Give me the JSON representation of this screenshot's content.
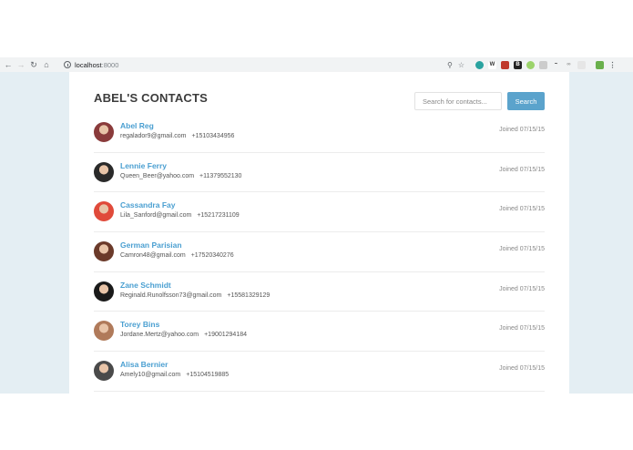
{
  "browser": {
    "url_host": "localhost",
    "url_port": ":8000"
  },
  "page": {
    "title": "ABEL'S CONTACTS",
    "search_placeholder": "Search for contacts...",
    "search_button": "Search"
  },
  "contacts": [
    {
      "name": "Abel Reg",
      "email": "regalador9@gmail.com",
      "phone": "+15103434956",
      "joined": "Joined 07/15/15",
      "avatar_color": "#8a3b3b"
    },
    {
      "name": "Lennie Ferry",
      "email": "Queen_Beer@yahoo.com",
      "phone": "+11379552130",
      "joined": "Joined 07/15/15",
      "avatar_color": "#2a2a2a"
    },
    {
      "name": "Cassandra Fay",
      "email": "Lila_Sanford@gmail.com",
      "phone": "+15217231109",
      "joined": "Joined 07/15/15",
      "avatar_color": "#e04a3a"
    },
    {
      "name": "German Parisian",
      "email": "Camron48@gmail.com",
      "phone": "+17520340276",
      "joined": "Joined 07/15/15",
      "avatar_color": "#6b3a2a"
    },
    {
      "name": "Zane Schmidt",
      "email": "Reginald.Runolfsson73@gmail.com",
      "phone": "+15581329129",
      "joined": "Joined 07/15/15",
      "avatar_color": "#1a1a1a"
    },
    {
      "name": "Torey Bins",
      "email": "Jordane.Mertz@yahoo.com",
      "phone": "+19001294184",
      "joined": "Joined 07/15/15",
      "avatar_color": "#b07a5a"
    },
    {
      "name": "Alisa Bernier",
      "email": "Amely10@gmail.com",
      "phone": "+15104519885",
      "joined": "Joined 07/15/15",
      "avatar_color": "#4a4a4a"
    }
  ],
  "colors": {
    "accent": "#5ba3cc",
    "link": "#4a9fd1",
    "background": "#e4eef3"
  }
}
